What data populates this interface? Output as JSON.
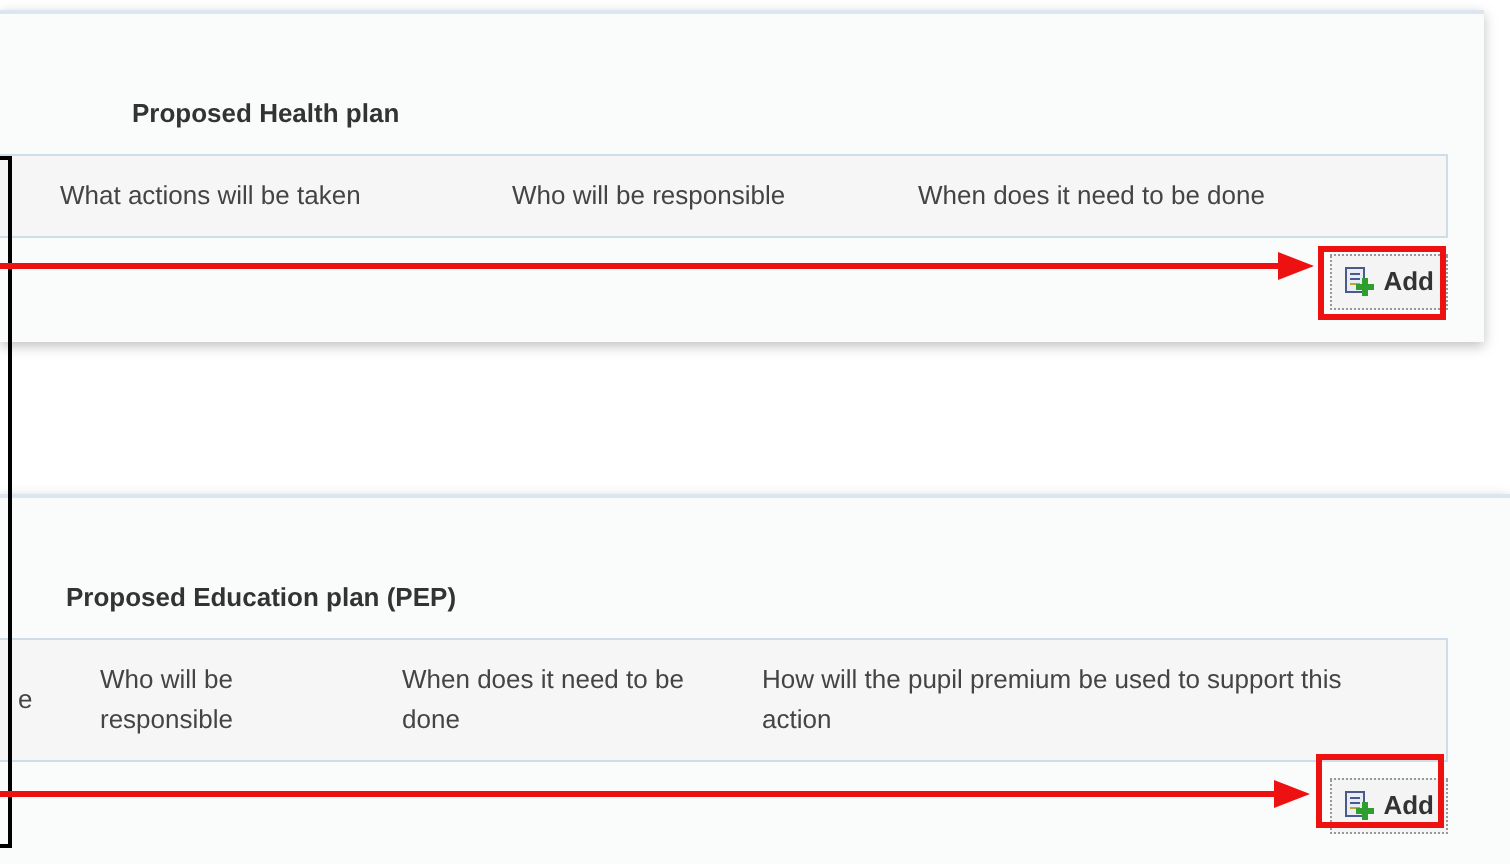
{
  "sections": [
    {
      "title": "Proposed Health plan",
      "columns": [
        "What actions will be taken",
        "Who will be responsible",
        "When does it need to be done"
      ],
      "add_button": "Add"
    },
    {
      "title": "Proposed Education plan (PEP)",
      "columns": [
        "e",
        "Who will be responsible",
        "When does it need to be done",
        "How will the pupil premium be used to support this action"
      ],
      "add_button": "Add"
    }
  ]
}
